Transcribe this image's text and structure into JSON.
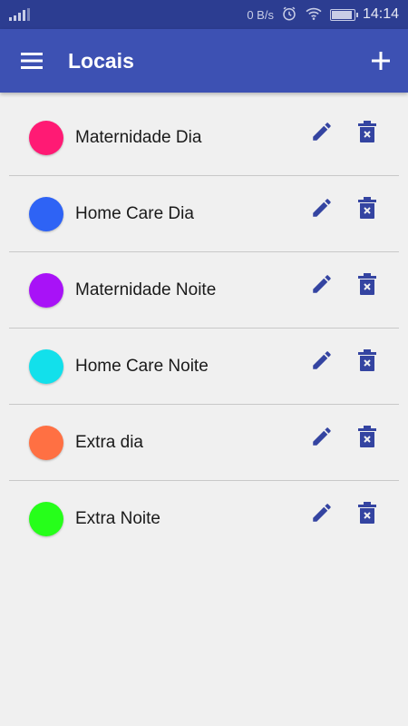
{
  "status_bar": {
    "net_speed": "0 B/s",
    "time": "14:14",
    "icons": [
      "signal-icon",
      "alarm-icon",
      "wifi-icon",
      "battery-icon"
    ]
  },
  "app_bar": {
    "title": "Locais",
    "left_icon": "menu-icon",
    "right_icon": "add-icon",
    "color": "#3d51b3"
  },
  "locations": [
    {
      "name": "Maternidade Dia",
      "color": "#ff1a74"
    },
    {
      "name": "Home Care Dia",
      "color": "#2e63f5"
    },
    {
      "name": "Maternidade Noite",
      "color": "#a812f7"
    },
    {
      "name": "Home Care Noite",
      "color": "#12e0eb"
    },
    {
      "name": "Extra dia",
      "color": "#ff7043"
    },
    {
      "name": "Extra Noite",
      "color": "#26ff1a"
    }
  ],
  "row_icons": {
    "edit": "pencil-icon",
    "delete": "trash-icon",
    "color": "#3444a1"
  }
}
